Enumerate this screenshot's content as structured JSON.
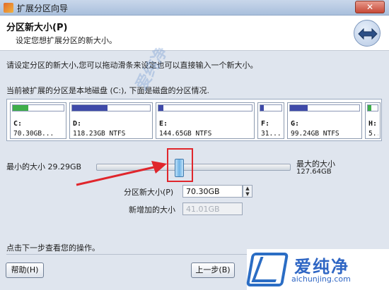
{
  "window": {
    "title": "扩展分区向导",
    "close_symbol": "✕"
  },
  "header": {
    "heading": "分区新大小(P)",
    "subheading": "设定您想扩展分区的新大小。"
  },
  "instructions": {
    "line1": "请设定分区的新大小,您可以拖动滑条来设定也可以直接输入一个新大小。",
    "line2": "当前被扩展的分区是本地磁盘 (C:), 下面是磁盘的分区情况."
  },
  "partitions": [
    {
      "drive": "C:",
      "info": "70.30GB...",
      "used": 0.3,
      "color": "#3fae49"
    },
    {
      "drive": "D:",
      "info": "118.23GB NTFS",
      "used": 0.45,
      "color": "#3f4aa8"
    },
    {
      "drive": "E:",
      "info": "144.65GB NTFS",
      "used": 0.05,
      "color": "#3f4aa8"
    },
    {
      "drive": "F:",
      "info": "31...",
      "used": 0.15,
      "color": "#3f4aa8"
    },
    {
      "drive": "G:",
      "info": "99.24GB NTFS",
      "used": 0.25,
      "color": "#3f4aa8"
    },
    {
      "drive": "H:",
      "info": "5...",
      "used": 0.35,
      "color": "#3fae49"
    }
  ],
  "slider": {
    "min_label": "最小的大小 29.29GB",
    "max_label": "最大的大小",
    "max_value": "127.64GB",
    "position": 0.42
  },
  "fields": {
    "new_size_label": "分区新大小(P)",
    "new_size_value": "70.30GB",
    "added_label": "新增加的大小",
    "added_value": "41.01GB"
  },
  "footer": {
    "hint": "点击下一步查看您的操作。",
    "help_button": "帮助(H)",
    "back_button": "上一步(B)"
  },
  "watermark": {
    "cn": "爱纯净",
    "en": "aichunjing.com",
    "bg_text": "爱纯净"
  },
  "colors": {
    "accent": "#2f66c4",
    "highlight": "#e0262c"
  }
}
